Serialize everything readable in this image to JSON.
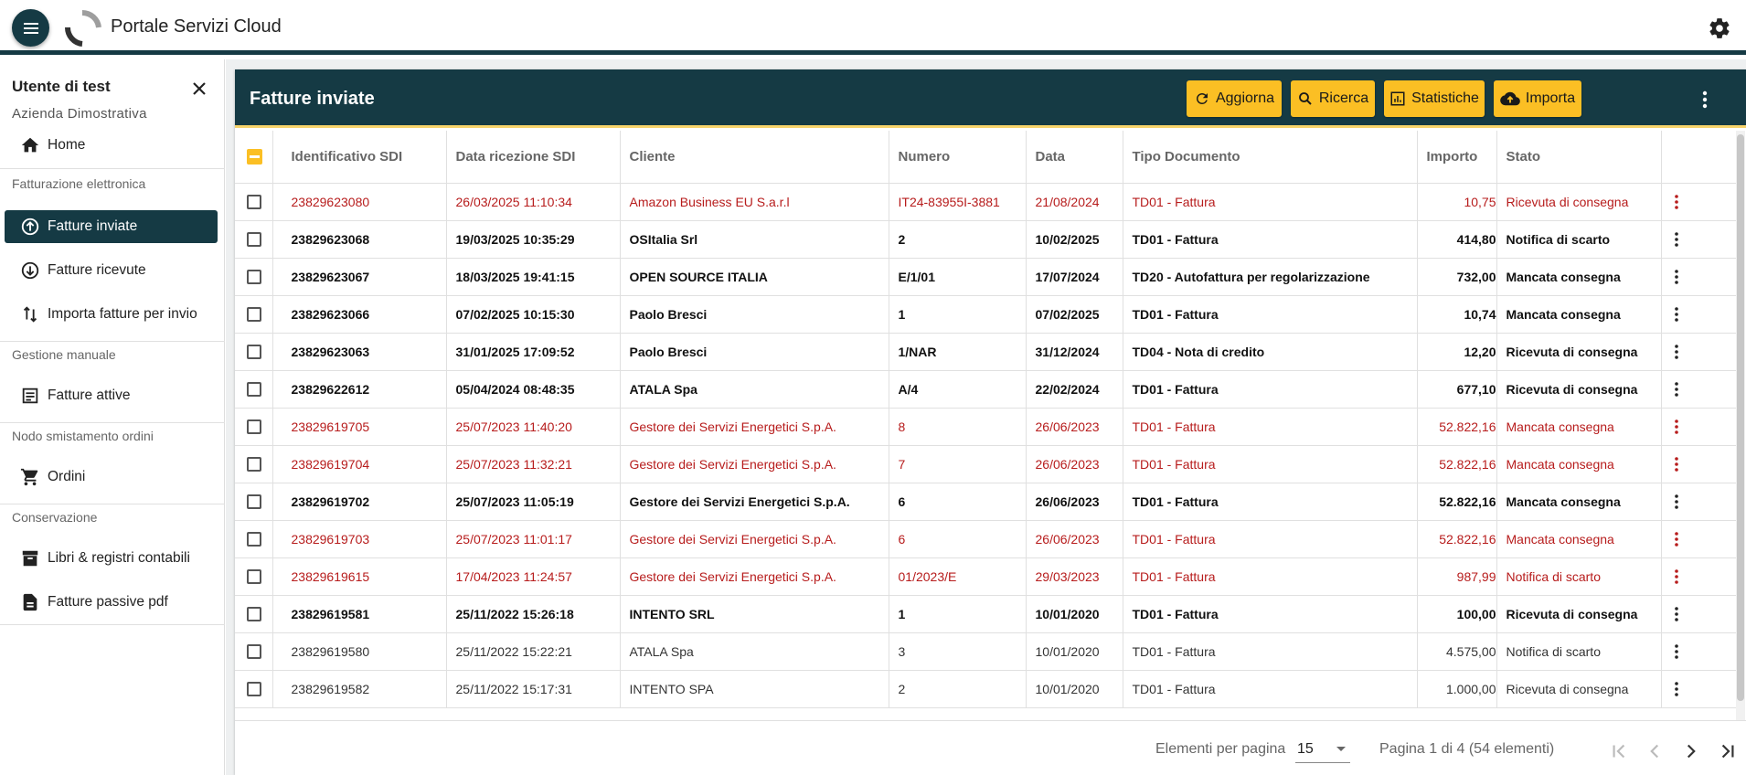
{
  "app": {
    "title": "Portale Servizi Cloud"
  },
  "sidebar": {
    "user_name": "Utente di test",
    "company": "Azienda Dimostrativa",
    "home": "Home",
    "sections": [
      "Fatturazione elettronica",
      "Gestione manuale",
      "Nodo smistamento ordini",
      "Conservazione"
    ],
    "items": {
      "fatture_inviate": "Fatture inviate",
      "fatture_ricevute": "Fatture ricevute",
      "importa": "Importa fatture per invio",
      "fatture_attive": "Fatture attive",
      "ordini": "Ordini",
      "libri": "Libri & registri contabili",
      "passive_pdf": "Fatture passive pdf"
    }
  },
  "main": {
    "title": "Fatture inviate",
    "buttons": {
      "aggiorna": "Aggiorna",
      "ricerca": "Ricerca",
      "statistiche": "Statistiche",
      "importa": "Importa"
    },
    "columns": [
      "Identificativo SDI",
      "Data ricezione SDI",
      "Cliente",
      "Numero",
      "Data",
      "Tipo Documento",
      "Importo",
      "Stato"
    ],
    "rows": [
      {
        "style": "red",
        "id": "23829623080",
        "ricezione": "26/03/2025 11:10:34",
        "cliente": "Amazon Business EU S.a.r.l",
        "numero": "IT24-83955I-3881",
        "data": "21/08/2024",
        "tipo": "TD01 - Fattura",
        "importo": "10,75",
        "stato": "Ricevuta di consegna"
      },
      {
        "style": "bold",
        "id": "23829623068",
        "ricezione": "19/03/2025 10:35:29",
        "cliente": "OSItalia Srl",
        "numero": "2",
        "data": "10/02/2025",
        "tipo": "TD01 - Fattura",
        "importo": "414,80",
        "stato": "Notifica di scarto"
      },
      {
        "style": "bold",
        "id": "23829623067",
        "ricezione": "18/03/2025 19:41:15",
        "cliente": "OPEN SOURCE ITALIA",
        "numero": "E/1/01",
        "data": "17/07/2024",
        "tipo": "TD20 - Autofattura per regolarizzazione",
        "importo": "732,00",
        "stato": "Mancata consegna"
      },
      {
        "style": "bold",
        "id": "23829623066",
        "ricezione": "07/02/2025 10:15:30",
        "cliente": "Paolo Bresci",
        "numero": "1",
        "data": "07/02/2025",
        "tipo": "TD01 - Fattura",
        "importo": "10,74",
        "stato": "Mancata consegna"
      },
      {
        "style": "bold",
        "id": "23829623063",
        "ricezione": "31/01/2025 17:09:52",
        "cliente": "Paolo Bresci",
        "numero": "1/NAR",
        "data": "31/12/2024",
        "tipo": "TD04 - Nota di credito",
        "importo": "12,20",
        "stato": "Ricevuta di consegna"
      },
      {
        "style": "bold",
        "id": "23829622612",
        "ricezione": "05/04/2024 08:48:35",
        "cliente": "ATALA Spa",
        "numero": "A/4",
        "data": "22/02/2024",
        "tipo": "TD01 - Fattura",
        "importo": "677,10",
        "stato": "Ricevuta di consegna"
      },
      {
        "style": "red",
        "id": "23829619705",
        "ricezione": "25/07/2023 11:40:20",
        "cliente": "Gestore dei Servizi Energetici S.p.A.",
        "numero": "8",
        "data": "26/06/2023",
        "tipo": "TD01 - Fattura",
        "importo": "52.822,16",
        "stato": "Mancata consegna"
      },
      {
        "style": "red",
        "id": "23829619704",
        "ricezione": "25/07/2023 11:32:21",
        "cliente": "Gestore dei Servizi Energetici S.p.A.",
        "numero": "7",
        "data": "26/06/2023",
        "tipo": "TD01 - Fattura",
        "importo": "52.822,16",
        "stato": "Mancata consegna"
      },
      {
        "style": "bold",
        "id": "23829619702",
        "ricezione": "25/07/2023 11:05:19",
        "cliente": "Gestore dei Servizi Energetici S.p.A.",
        "numero": "6",
        "data": "26/06/2023",
        "tipo": "TD01 - Fattura",
        "importo": "52.822,16",
        "stato": "Mancata consegna"
      },
      {
        "style": "red",
        "id": "23829619703",
        "ricezione": "25/07/2023 11:01:17",
        "cliente": "Gestore dei Servizi Energetici S.p.A.",
        "numero": "6",
        "data": "26/06/2023",
        "tipo": "TD01 - Fattura",
        "importo": "52.822,16",
        "stato": "Mancata consegna"
      },
      {
        "style": "red",
        "id": "23829619615",
        "ricezione": "17/04/2023 11:24:57",
        "cliente": "Gestore dei Servizi Energetici S.p.A.",
        "numero": "01/2023/E",
        "data": "29/03/2023",
        "tipo": "TD01 - Fattura",
        "importo": "987,99",
        "stato": "Notifica di scarto"
      },
      {
        "style": "bold",
        "id": "23829619581",
        "ricezione": "25/11/2022 15:26:18",
        "cliente": "INTENTO SRL",
        "numero": "1",
        "data": "10/01/2020",
        "tipo": "TD01 - Fattura",
        "importo": "100,00",
        "stato": "Ricevuta di consegna"
      },
      {
        "style": "normal",
        "id": "23829619580",
        "ricezione": "25/11/2022 15:22:21",
        "cliente": "ATALA Spa",
        "numero": "3",
        "data": "10/01/2020",
        "tipo": "TD01 - Fattura",
        "importo": "4.575,00",
        "stato": "Notifica di scarto"
      },
      {
        "style": "normal",
        "id": "23829619582",
        "ricezione": "25/11/2022 15:17:31",
        "cliente": "INTENTO SPA",
        "numero": "2",
        "data": "10/01/2020",
        "tipo": "TD01 - Fattura",
        "importo": "1.000,00",
        "stato": "Ricevuta di consegna"
      }
    ]
  },
  "paginator": {
    "label": "Elementi per pagina",
    "page_size": "15",
    "range": "Pagina 1 di 4 (54 elementi)"
  },
  "colors": {
    "primary": "#153a44",
    "accent": "#fbbf24",
    "error_row": "#b71c1c"
  }
}
